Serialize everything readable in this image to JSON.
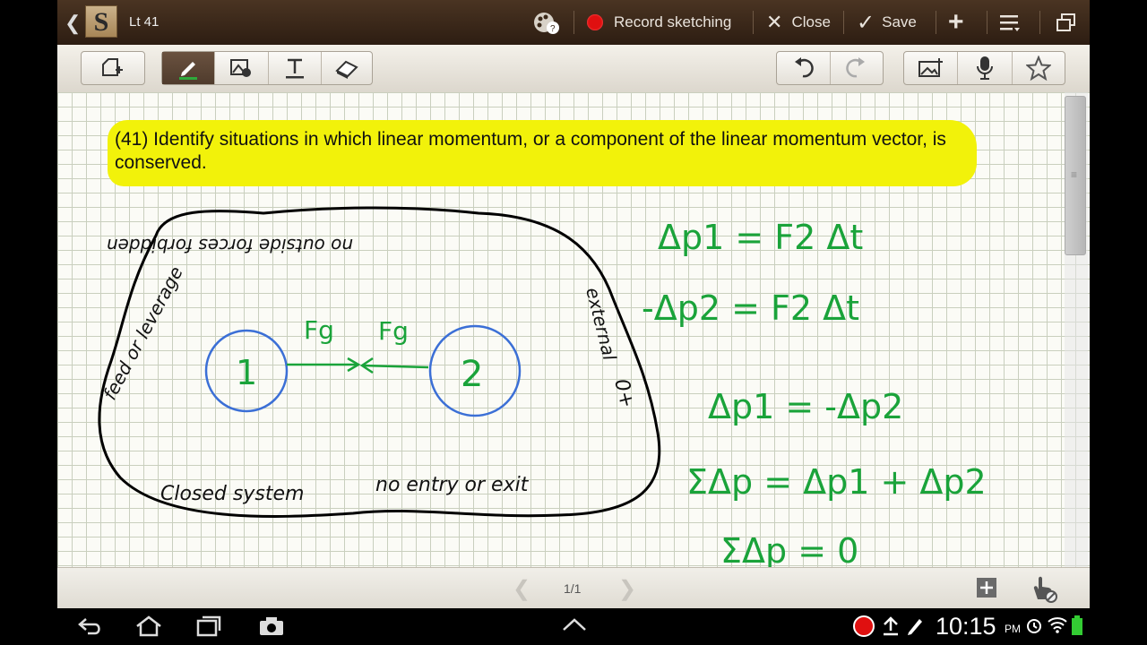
{
  "app": {
    "logo_letter": "S",
    "document_title": "Lt 41"
  },
  "topbar": {
    "record_label": "Record sketching",
    "close_label": "Close",
    "save_label": "Save",
    "colors": {
      "record": "#e01010",
      "bar": "#3a2819"
    }
  },
  "toolbar": {
    "left_tools": [
      "selection-mode-icon"
    ],
    "drawing_tools": [
      "pen-icon",
      "image-icon",
      "text-icon",
      "eraser-icon"
    ],
    "active_tool": "pen-icon",
    "history": [
      "undo-icon",
      "redo-icon"
    ],
    "insert": [
      "insert-image-icon",
      "microphone-icon",
      "star-icon"
    ]
  },
  "note": {
    "heading": "(41) Identify situations in which linear momentum, or a component of the linear momentum vector, is conserved.",
    "highlight_color": "#f2f20a",
    "sketch": {
      "system_label": "Closed system",
      "boundary_label": "no entry or exit",
      "rim_text_top": "no outside forces forbidden",
      "rim_text_left": "feed or leverage",
      "rim_text_right": "external",
      "rim_text_bottom_right": "0+",
      "object_1": "1",
      "object_2": "2",
      "force_label": "Fg",
      "ink_colors": {
        "boundary": "#000000",
        "objects": "#3b6fd6",
        "equations": "#1aa33a"
      },
      "equations": [
        "Δp1 = F2 Δt",
        "-Δp2 = F2 Δt",
        "Δp1 = -Δp2",
        "ΣΔp = Δp1 + Δp2",
        "ΣΔp = 0"
      ]
    }
  },
  "pager": {
    "page_indicator": "1/1"
  },
  "status": {
    "time": "10:15",
    "ampm": "PM"
  }
}
